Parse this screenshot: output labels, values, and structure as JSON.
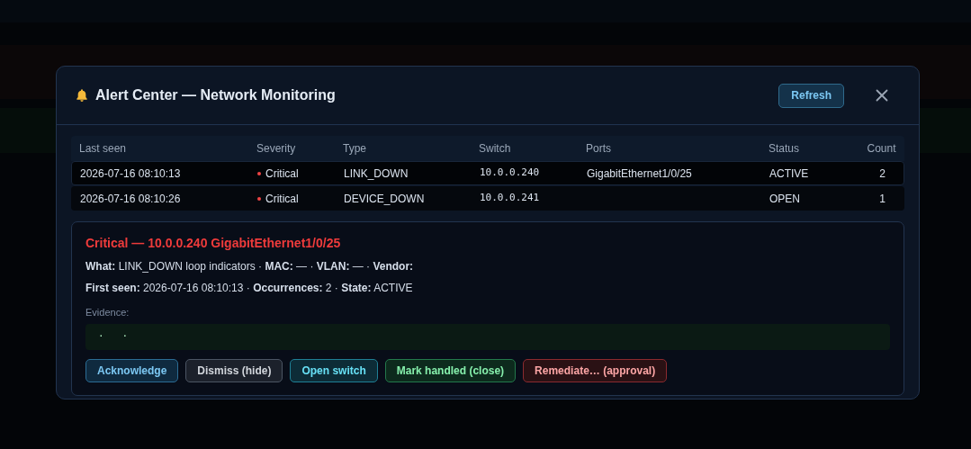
{
  "dialog": {
    "title": "Alert Center — Network Monitoring",
    "refresh_button": "Refresh"
  },
  "table": {
    "columns": [
      "Last seen",
      "Severity",
      "Type",
      "Switch",
      "Ports",
      "Status",
      "Count"
    ],
    "rows": [
      {
        "last_seen": "2026-07-16 08:10:13",
        "severity": "Critical",
        "color": "#ef4444",
        "type": "LINK_DOWN",
        "switch": "10.0.0.240",
        "ports": "GigabitEthernet1/0/25",
        "status": "ACTIVE",
        "count": "2",
        "selected": true
      },
      {
        "last_seen": "2026-07-16 08:10:26",
        "severity": "Critical",
        "color": "#ef4444",
        "type": "DEVICE_DOWN",
        "switch": "10.0.0.241",
        "ports": "",
        "status": "OPEN",
        "count": "1",
        "selected": false
      }
    ]
  },
  "detail": {
    "heading": "Critical — 10.0.0.240 GigabitEthernet1/0/25",
    "lines": [
      "**What:** LINK_DOWN loop indicators · **MAC:** — · **VLAN:** — · **Vendor:**",
      "**First seen:** 2026-07-16 08:10:13 · **Occurrences:** 2 · **State:** ACTIVE"
    ],
    "evidence_label": "Evidence:",
    "evidence": "·   ·",
    "actions": [
      {
        "label": "Acknowledge",
        "kind": "blue"
      },
      {
        "label": "Dismiss (hide)",
        "kind": "gray"
      },
      {
        "label": "Open switch",
        "kind": "cyan"
      },
      {
        "label": "Mark handled (close)",
        "kind": "green"
      },
      {
        "label": "Remediate… (approval)",
        "kind": "red"
      }
    ]
  }
}
